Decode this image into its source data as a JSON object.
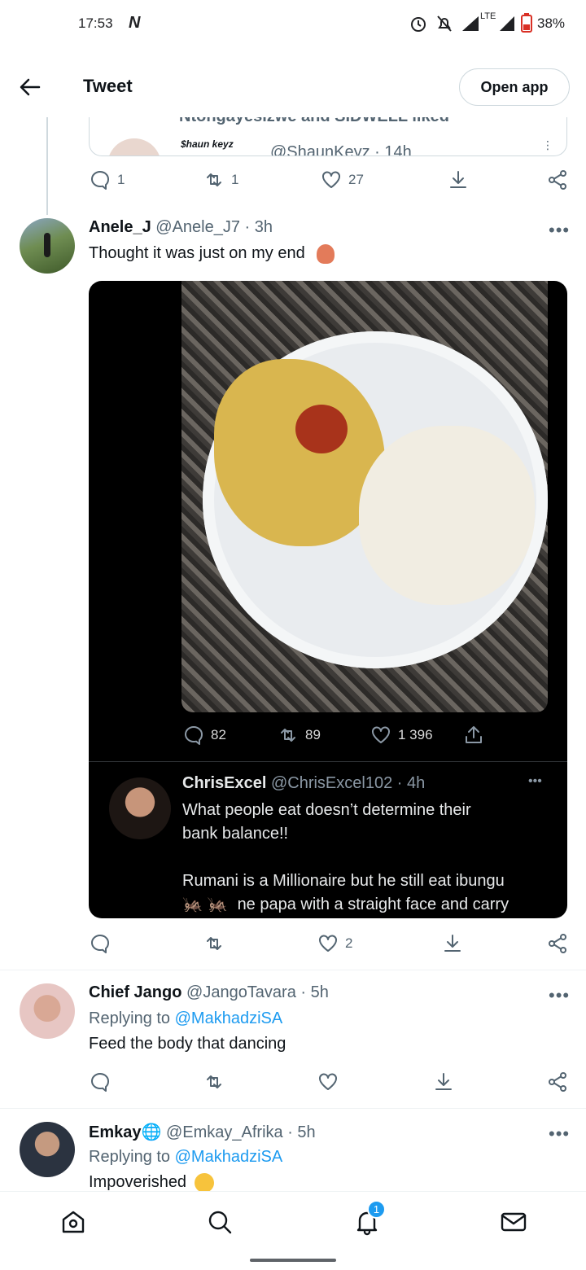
{
  "status_bar": {
    "time": "17:53",
    "network": "LTE",
    "battery": "38%"
  },
  "header": {
    "title": "Tweet",
    "open_app_label": "Open app"
  },
  "quoted_partial": {
    "line1": "Ntongayesizwe and SIDWELL liked",
    "author_handle": "@ShaunKeyz · 14h",
    "avatar_text": "$haun keyz"
  },
  "top_tweet_actions": {
    "replies": "1",
    "retweets": "1",
    "likes": "27"
  },
  "tweet_anele": {
    "name": "Anele_J",
    "handle_time": "@Anele_J7 · 3h",
    "text": "Thought it was just on my end",
    "media_stats": {
      "replies": "82",
      "retweets": "89",
      "likes": "1 396"
    },
    "quoted": {
      "name": "ChrisExcel",
      "handle_time": "@ChrisExcel102 · 4h",
      "text_line1": "What people eat doesn’t determine their",
      "text_line2": "bank balance!!",
      "text_line3": "Rumani is a Millionaire but he still eat ibungu",
      "text_line4": "ne papa with a straight face and carry"
    },
    "actions": {
      "likes": "2"
    }
  },
  "tweet_jango": {
    "name": "Chief Jango",
    "handle_time": "@JangoTavara · 5h",
    "replying_prefix": "Replying to",
    "replying_to": "@MakhadziSA",
    "text": "Feed the body that dancing"
  },
  "tweet_emkay": {
    "name": "Emkay",
    "handle_time": "@Emkay_Afrika · 5h",
    "replying_prefix": "Replying to",
    "replying_to": "@MakhadziSA",
    "text": "Impoverished"
  },
  "bottom_nav": {
    "notifications_badge": "1"
  }
}
